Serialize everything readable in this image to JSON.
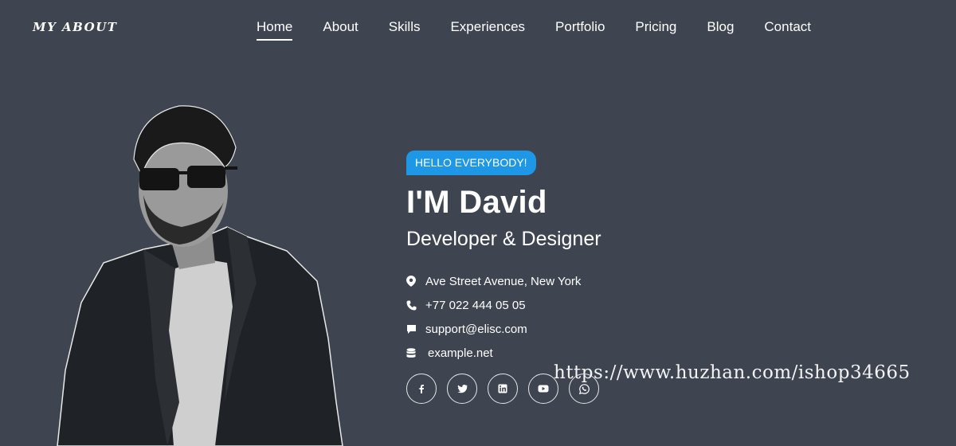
{
  "header": {
    "logo": "MY ABOUT",
    "nav": [
      {
        "label": "Home",
        "active": true
      },
      {
        "label": "About"
      },
      {
        "label": "Skills"
      },
      {
        "label": "Experiences"
      },
      {
        "label": "Portfolio"
      },
      {
        "label": "Pricing"
      },
      {
        "label": "Blog"
      },
      {
        "label": "Contact"
      }
    ]
  },
  "hero": {
    "badge": "HELLO EVERYBODY!",
    "name": "I'M David",
    "role": "Developer & Designer",
    "contacts": [
      {
        "icon": "map-marker-icon",
        "text": "Ave Street Avenue, New York"
      },
      {
        "icon": "phone-icon",
        "text": "+77 022 444 05 05"
      },
      {
        "icon": "chat-icon",
        "text": "support@elisc.com"
      },
      {
        "icon": "database-icon",
        "text": "example.net"
      }
    ],
    "socials": [
      "facebook-icon",
      "twitter-icon",
      "linkedin-icon",
      "youtube-icon",
      "whatsapp-icon"
    ]
  },
  "watermark": "https://www.huzhan.com/ishop34665",
  "colors": {
    "background": "#3f4451",
    "badge": "#1e97e6",
    "text": "#ffffff"
  }
}
